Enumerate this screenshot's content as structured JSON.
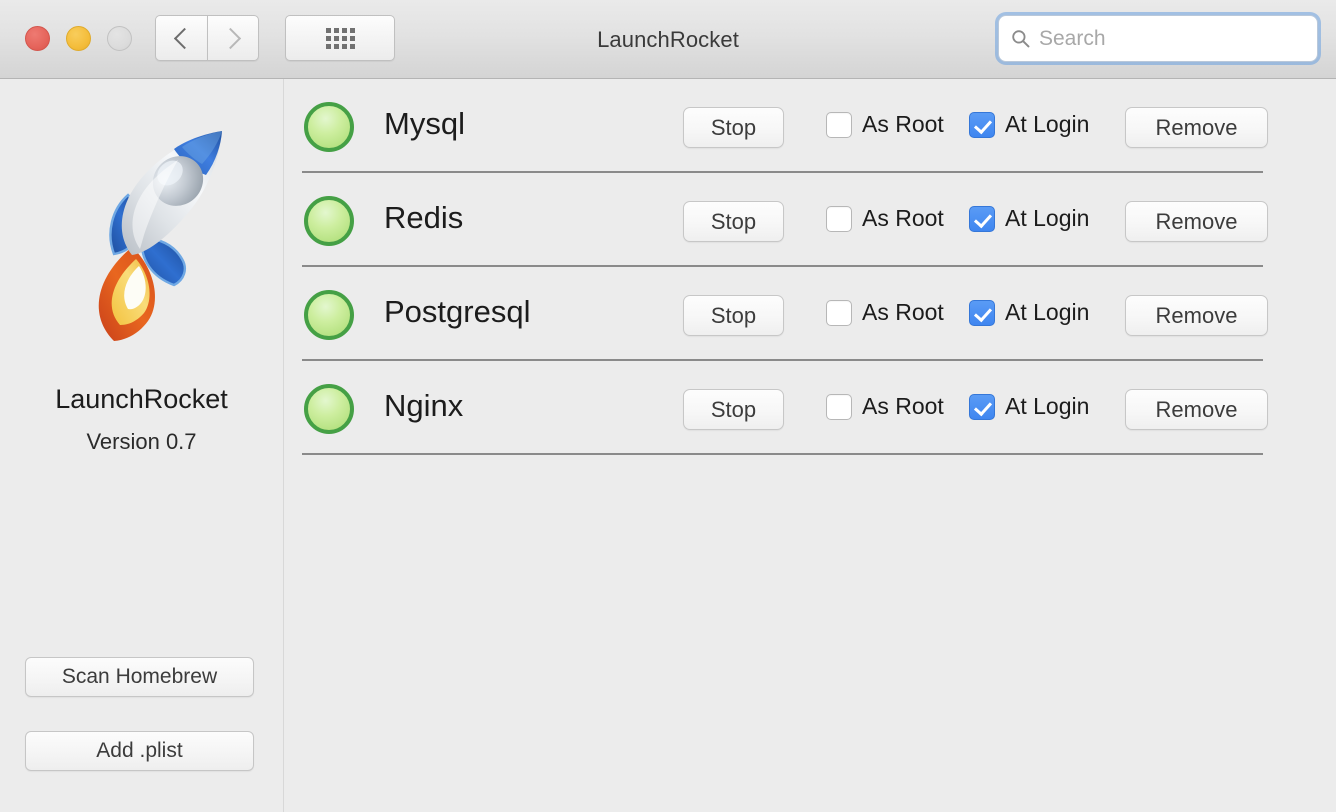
{
  "window": {
    "title": "LaunchRocket",
    "traffic_lights": [
      {
        "name": "close",
        "color": "#e5645b"
      },
      {
        "name": "minimize",
        "color": "#f4bd3b"
      },
      {
        "name": "zoom",
        "color": "#dcdcdc"
      }
    ],
    "nav": {
      "back_icon": "chevron-left-icon",
      "forward_icon": "chevron-right-icon",
      "grid_icon": "grid-view-icon"
    },
    "search": {
      "placeholder": "Search",
      "value": "",
      "icon": "search-icon",
      "focused": true,
      "focus_ring_color": "#6aa0e0"
    }
  },
  "sidebar": {
    "app_icon": "rocket-icon",
    "app_name": "LaunchRocket",
    "version": "Version 0.7",
    "buttons": [
      {
        "name": "scan-homebrew-button",
        "label": "Scan Homebrew"
      },
      {
        "name": "add-plist-button",
        "label": "Add .plist"
      }
    ]
  },
  "services": {
    "columns": [
      "status",
      "name",
      "action",
      "as_root",
      "at_login",
      "remove"
    ],
    "labels": {
      "as_root": "As Root",
      "at_login": "At Login",
      "remove": "Remove"
    },
    "status_colors": {
      "running": "#45a045",
      "stopped": "#b0b0b0"
    },
    "rows": [
      {
        "name": "Mysql",
        "status": "running",
        "action_label": "Stop",
        "as_root": false,
        "at_login": true,
        "remove_label": "Remove"
      },
      {
        "name": "Redis",
        "status": "running",
        "action_label": "Stop",
        "as_root": false,
        "at_login": true,
        "remove_label": "Remove"
      },
      {
        "name": "Postgresql",
        "status": "running",
        "action_label": "Stop",
        "as_root": false,
        "at_login": true,
        "remove_label": "Remove"
      },
      {
        "name": "Nginx",
        "status": "running",
        "action_label": "Stop",
        "as_root": false,
        "at_login": true,
        "remove_label": "Remove"
      }
    ]
  }
}
